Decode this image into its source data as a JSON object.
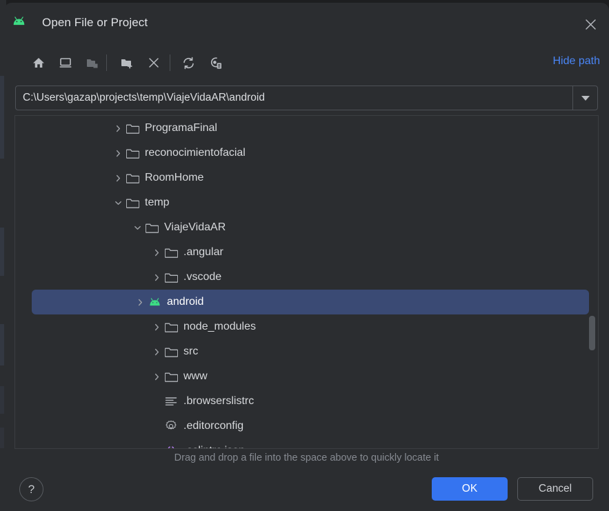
{
  "window": {
    "title": "Open File or Project",
    "app_icon": "android-logo-icon",
    "close_icon": "close-icon"
  },
  "toolbar": {
    "buttons": [
      {
        "name": "home-icon",
        "tooltip": "Home"
      },
      {
        "name": "desktop-icon",
        "tooltip": "Desktop"
      },
      {
        "name": "project-folder-icon",
        "tooltip": "Project Directory"
      },
      {
        "name": "new-folder-icon",
        "tooltip": "New Folder"
      },
      {
        "name": "delete-icon",
        "tooltip": "Delete"
      },
      {
        "name": "refresh-icon",
        "tooltip": "Refresh"
      },
      {
        "name": "show-hidden-icon",
        "tooltip": "Show Hidden Files and Directories"
      }
    ],
    "hide_path_label": "Hide path"
  },
  "path_field": {
    "value": "C:\\Users\\gazap\\projects\\temp\\ViajeVidaAR\\android",
    "placeholder": "",
    "dropdown_icon": "chevron-down-icon"
  },
  "tree": {
    "items": [
      {
        "label": "ProgramaFinal",
        "depth": 4,
        "icon": "folder-icon",
        "arrow": "collapsed",
        "selected": false
      },
      {
        "label": "reconocimientofacial",
        "depth": 4,
        "icon": "folder-icon",
        "arrow": "collapsed",
        "selected": false
      },
      {
        "label": "RoomHome",
        "depth": 4,
        "icon": "folder-icon",
        "arrow": "collapsed",
        "selected": false
      },
      {
        "label": "temp",
        "depth": 4,
        "icon": "folder-icon",
        "arrow": "expanded",
        "selected": false
      },
      {
        "label": "ViajeVidaAR",
        "depth": 5,
        "icon": "folder-icon",
        "arrow": "expanded",
        "selected": false
      },
      {
        "label": ".angular",
        "depth": 6,
        "icon": "folder-icon",
        "arrow": "collapsed",
        "selected": false
      },
      {
        "label": ".vscode",
        "depth": 6,
        "icon": "folder-icon",
        "arrow": "collapsed",
        "selected": false
      },
      {
        "label": "android",
        "depth": 6,
        "icon": "android-logo-icon",
        "arrow": "collapsed",
        "selected": true
      },
      {
        "label": "node_modules",
        "depth": 6,
        "icon": "folder-icon",
        "arrow": "collapsed",
        "selected": false
      },
      {
        "label": "src",
        "depth": 6,
        "icon": "folder-icon",
        "arrow": "collapsed",
        "selected": false
      },
      {
        "label": "www",
        "depth": 6,
        "icon": "folder-icon",
        "arrow": "collapsed",
        "selected": false
      },
      {
        "label": ".browserslistrc",
        "depth": 6,
        "icon": "text-file-icon",
        "arrow": "none",
        "selected": false
      },
      {
        "label": ".editorconfig",
        "depth": 6,
        "icon": "gear-file-icon",
        "arrow": "none",
        "selected": false
      },
      {
        "label": ".eslintrc.json",
        "depth": 6,
        "icon": "json-file-icon",
        "arrow": "none",
        "selected": false
      }
    ]
  },
  "hint": "Drag and drop a file into the space above to quickly locate it",
  "footer": {
    "help_label": "?",
    "ok_label": "OK",
    "cancel_label": "Cancel"
  },
  "colors": {
    "dialog_bg": "#2b2d30",
    "selection_blue": "#3a4a74",
    "accent_blue": "#3574f0",
    "link_blue": "#4a86f7",
    "android_green": "#3ddc84",
    "text_primary": "#d6d8db",
    "text_muted": "#868a91"
  }
}
